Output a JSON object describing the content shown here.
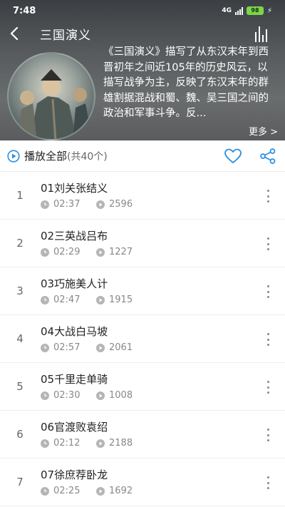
{
  "status": {
    "time": "7:48",
    "network": "4G",
    "battery": "98"
  },
  "header": {
    "title": "三国演义",
    "description": "《三国演义》描写了从东汉末年到西晋初年之间近105年的历史风云，以描写战争为主，反映了东汉末年的群雄割据混战和蜀、魏、吴三国之间的政治和军事斗争。反...",
    "more_label": "更多 >"
  },
  "actions": {
    "play_all": "播放全部",
    "count": "(共40个)"
  },
  "colors": {
    "accent": "#2a8ee0",
    "header_bg": "#54585b"
  },
  "episodes": [
    {
      "num": "1",
      "title": "01刘关张结义",
      "duration": "02:37",
      "plays": "2596"
    },
    {
      "num": "2",
      "title": "02三英战吕布",
      "duration": "02:29",
      "plays": "1227"
    },
    {
      "num": "3",
      "title": "03巧施美人计",
      "duration": "02:47",
      "plays": "1915"
    },
    {
      "num": "4",
      "title": "04大战白马坡",
      "duration": "02:57",
      "plays": "2061"
    },
    {
      "num": "5",
      "title": "05千里走单骑",
      "duration": "02:30",
      "plays": "1008"
    },
    {
      "num": "6",
      "title": "06官渡败袁绍",
      "duration": "02:12",
      "plays": "2188"
    },
    {
      "num": "7",
      "title": "07徐庶荐卧龙",
      "duration": "02:25",
      "plays": "1692"
    }
  ]
}
